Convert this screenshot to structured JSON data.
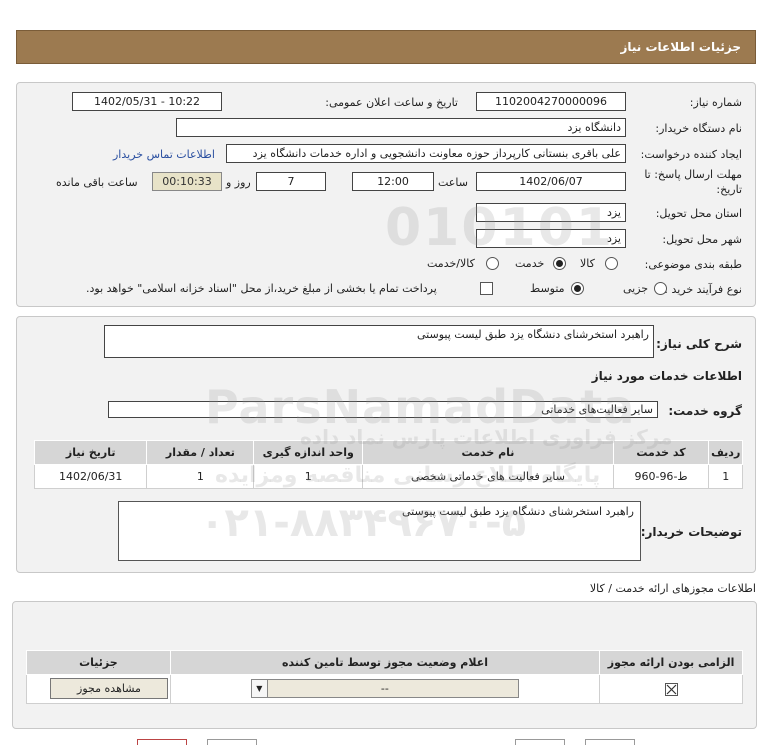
{
  "header": {
    "title": "جزئیات اطلاعات نیاز"
  },
  "form": {
    "need_number_label": "شماره نیاز:",
    "need_number": "1102004270000096",
    "announce_label": "تاریخ و ساعت اعلان عمومی:",
    "announce_value": "1402/05/31 - 10:22",
    "buyer_org_label": "نام دستگاه خریدار:",
    "buyer_org": "دانشگاه یزد",
    "creator_label": "ایجاد کننده درخواست:",
    "creator": "علی باقری بنستانی کارپرداز حوزه معاونت دانشجویی و اداره خدمات دانشگاه یزد",
    "contact_link": "اطلاعات تماس خریدار",
    "deadline_label_1": "مهلت ارسال پاسخ: تا",
    "deadline_label_2": "تاریخ:",
    "deadline_date": "1402/06/07",
    "time_label": "ساعت",
    "deadline_time": "12:00",
    "days_value": "7",
    "days_label": "روز و",
    "remaining_time": "00:10:33",
    "remaining_label": "ساعت باقی مانده",
    "province_label": "استان محل تحویل:",
    "province": "یزد",
    "city_label": "شهر محل تحویل:",
    "city": "یزد",
    "category_label": "طبقه بندی موضوعی:",
    "category_options": [
      "کالا",
      "خدمت",
      "کالا/خدمت"
    ],
    "category_selected": "خدمت",
    "process_label": "نوع فرآیند خرید :",
    "process_options": [
      "جزیی",
      "متوسط"
    ],
    "process_selected": "متوسط",
    "treasury_note": "پرداخت تمام یا بخشی از مبلغ خرید،از محل \"اسناد خزانه اسلامی\" خواهد بود."
  },
  "summary": {
    "label": "شرح کلی نیاز:",
    "text": "راهبرد استخرشنای دنشگاه یزد طبق لیست پیوستی",
    "services_title": "اطلاعات خدمات مورد نیاز",
    "group_label": "گروه خدمت:",
    "group_value": "سایر فعالیت‌های خدماتی"
  },
  "service_table": {
    "headers": [
      "ردیف",
      "کد خدمت",
      "نام خدمت",
      "واحد اندازه گیری",
      "تعداد / مقدار",
      "تاریخ نیاز"
    ],
    "rows": [
      [
        "1",
        "ط-96-960",
        "سایر فعالیت های خدماتی شخصی",
        "1",
        "1",
        "1402/06/31"
      ]
    ]
  },
  "buyer_notes": {
    "label": "توضیحات خریدار:",
    "text": "راهبرد استخرشنای دنشگاه یزد طبق لیست پیوستی"
  },
  "permits": {
    "title": "اطلاعات مجوزهای ارائه خدمت / کالا",
    "headers": [
      "الزامی بودن ارائه مجوز",
      "اعلام وضعیت مجوز توسط تامین کننده",
      "جزئیات"
    ],
    "select_value": "--",
    "view_button": "مشاهده مجوز"
  },
  "watermark": {
    "line1": "ParsNamadData",
    "line2": "مرکز فراوری اطلاعات پارس نماد داده",
    "line3": "پایگاه اطلاع رسانی مناقصه ومزایده",
    "phone": "۰۲۱-۸۸۳۴۹۶۷۰-۵",
    "digits": "010101"
  },
  "colors": {
    "header_bg": "#9c7a50",
    "panel_bg": "#f2f2f2",
    "link": "#2a4fa0"
  }
}
